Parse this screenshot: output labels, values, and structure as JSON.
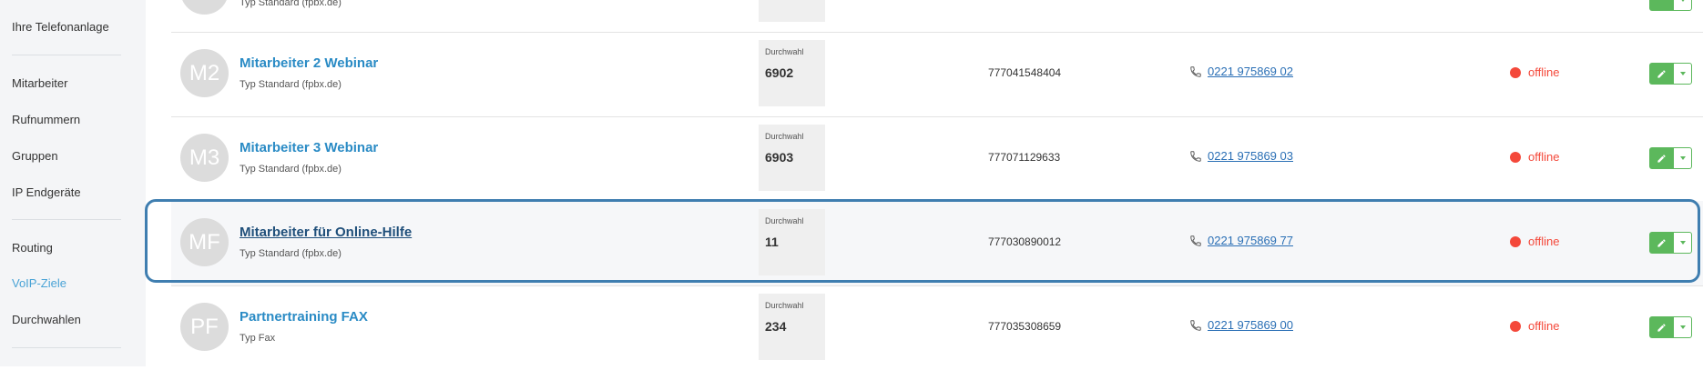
{
  "sidebar": {
    "items": [
      {
        "label": "Ihre Telefonanlage"
      },
      {
        "label": "Mitarbeiter"
      },
      {
        "label": "Rufnummern"
      },
      {
        "label": "Gruppen"
      },
      {
        "label": "IP Endgeräte"
      },
      {
        "label": "Routing"
      },
      {
        "label": "VoIP-Ziele"
      },
      {
        "label": "Durchwahlen"
      }
    ]
  },
  "top_row": {
    "type_label": "Typ Standard (fpbx.de)"
  },
  "rows": [
    {
      "initials": "M2",
      "name": "Mitarbeiter 2 Webinar",
      "type": "Typ Standard (fpbx.de)",
      "durchwahl_label": "Durchwahl",
      "durchwahl": "6902",
      "number": "777041548404",
      "phone": "0221 975869 02",
      "status": "offline"
    },
    {
      "initials": "M3",
      "name": "Mitarbeiter 3 Webinar",
      "type": "Typ Standard (fpbx.de)",
      "durchwahl_label": "Durchwahl",
      "durchwahl": "6903",
      "number": "777071129633",
      "phone": "0221 975869 03",
      "status": "offline"
    },
    {
      "initials": "MF",
      "name": "Mitarbeiter für Online-Hilfe",
      "type": "Typ Standard (fpbx.de)",
      "durchwahl_label": "Durchwahl",
      "durchwahl": "11",
      "number": "777030890012",
      "phone": "0221 975869 77",
      "status": "offline"
    },
    {
      "initials": "PF",
      "name": "Partnertraining FAX",
      "type": "Typ Fax",
      "durchwahl_label": "Durchwahl",
      "durchwahl": "234",
      "number": "777035308659",
      "phone": "0221 975869 00",
      "status": "offline"
    }
  ],
  "colors": {
    "accent": "#2a8bc5",
    "status_offline": "#f4483a",
    "edit_button": "#5cb85c",
    "highlight_border": "#3f7eb0"
  },
  "icons": {
    "phone": "phone-icon",
    "edit": "pencil-icon",
    "dropdown": "caret-down-icon",
    "status": "status-dot-icon"
  }
}
